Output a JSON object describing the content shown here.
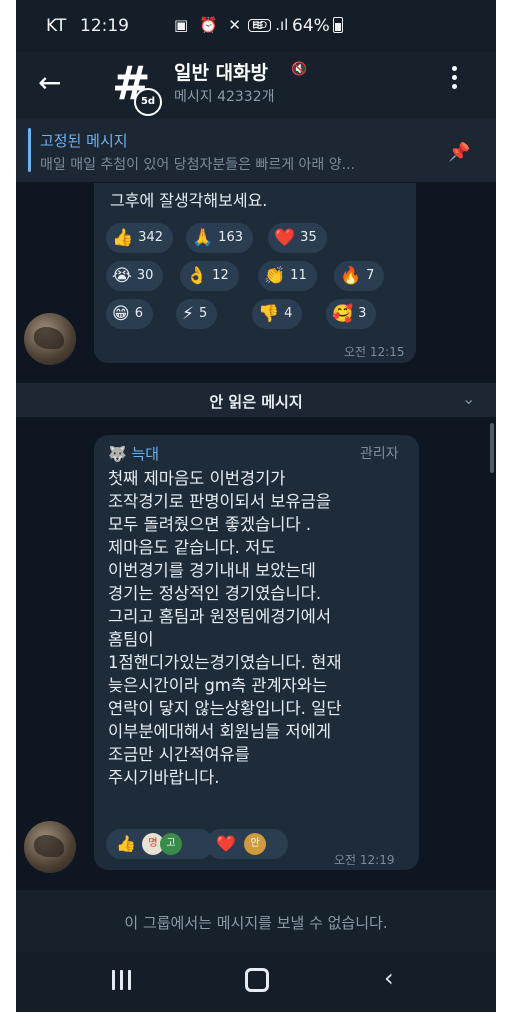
{
  "status_bar": {
    "carrier": "KT",
    "time": "12:19",
    "icons": "▣ ⏰ ✕ ≋",
    "hd": "HD",
    "signal": ".ıl",
    "battery": "64%"
  },
  "header": {
    "title": "일반 대화방",
    "subtitle": "메시지 42332개",
    "avatar_symbol": "#",
    "avatar_timer": "5d"
  },
  "pinned": {
    "title": "고정된 메시지",
    "text": "매일 매일 추첨이 있어 당첨자분들은 빠르게 아래 양..."
  },
  "messages": {
    "first": {
      "partial_text": "그후에 잘생각해보세요.",
      "reactions": [
        {
          "emoji": "👍",
          "count": "342"
        },
        {
          "emoji": "🙏",
          "count": "163"
        },
        {
          "emoji": "❤️",
          "count": "35"
        },
        {
          "emoji": "😭",
          "count": "30"
        },
        {
          "emoji": "👌",
          "count": "12"
        },
        {
          "emoji": "👏",
          "count": "11"
        },
        {
          "emoji": "🔥",
          "count": "7"
        },
        {
          "emoji": "😁",
          "count": "6"
        },
        {
          "emoji": "⚡",
          "count": "5"
        },
        {
          "emoji": "👎",
          "count": "4"
        },
        {
          "emoji": "🥰",
          "count": "3"
        }
      ],
      "time": "오전 12:15"
    },
    "unread_divider": "안 읽은 메시지",
    "second": {
      "sender": "늑대",
      "sender_icon": "🐺",
      "role": "관리자",
      "text": "첫째 제마음도 이번경기가\n조작경기로 판명이되서 보유금을\n모두 돌려줬으면 좋겠습니다 .\n제마음도 같습니다. 저도\n이번경기를 경기내내 보았는데\n경기는 정상적인 경기였습니다.\n그리고 홈팀과 원정팀에경기에서\n홈팀이\n1점핸디가있는경기였습니다. 현재\n늦은시간이라 gm측 관계자와는\n연락이 닿지 않는상황입니다. 일단\n이부분에대해서 회원님들 저에게\n조금만 시간적여유를\n주시기바랍니다.",
      "reaction_left_emoji": "👍",
      "reaction_left_avatar1": "명",
      "reaction_left_avatar2": "고",
      "reaction_right_emoji": "❤️",
      "reaction_right_avatar": "안",
      "time": "오전 12:19"
    }
  },
  "footer": {
    "no_send": "이 그룹에서는 메시지를 보낼 수 없습니다."
  },
  "colors": {
    "background": "#0e1621",
    "bubble": "#1e2c3a",
    "accent": "#6ab2f2"
  }
}
